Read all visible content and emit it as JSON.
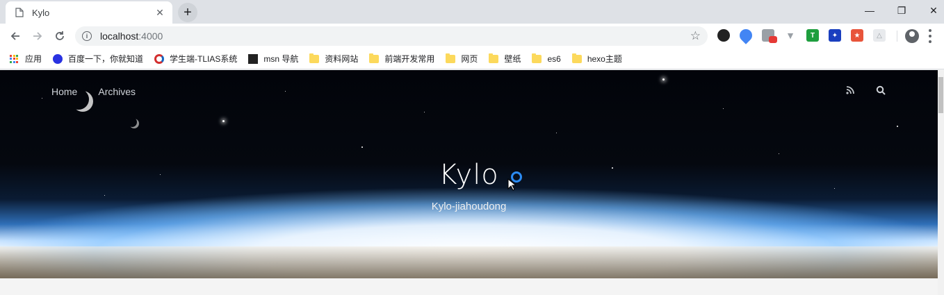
{
  "tab": {
    "title": "Kylo"
  },
  "window": {
    "minimize": "—",
    "restore": "❐",
    "close": "✕"
  },
  "toolbar": {
    "url_host": "localhost",
    "url_port": ":4000"
  },
  "bookmarks": [
    {
      "label": "应用",
      "icon": "apps-grid-icon"
    },
    {
      "label": "百度一下，你就知道",
      "icon": "baidu-paw-icon"
    },
    {
      "label": "学生端-TLIAS系统",
      "icon": "tlias-icon"
    },
    {
      "label": "msn 导航",
      "icon": "msn-icon"
    },
    {
      "label": "资料网站",
      "icon": "folder-icon"
    },
    {
      "label": "前端开发常用",
      "icon": "folder-icon"
    },
    {
      "label": "网页",
      "icon": "folder-icon"
    },
    {
      "label": "壁纸",
      "icon": "folder-icon"
    },
    {
      "label": "es6",
      "icon": "folder-icon"
    },
    {
      "label": "hexo主题",
      "icon": "folder-icon"
    }
  ],
  "page": {
    "nav": {
      "home": "Home",
      "archives": "Archives"
    },
    "title": "Kylo",
    "subtitle": "Kylo-jiahoudong"
  },
  "colors": {
    "accent": "#2b8bf2",
    "folder": "#fcd95c"
  }
}
